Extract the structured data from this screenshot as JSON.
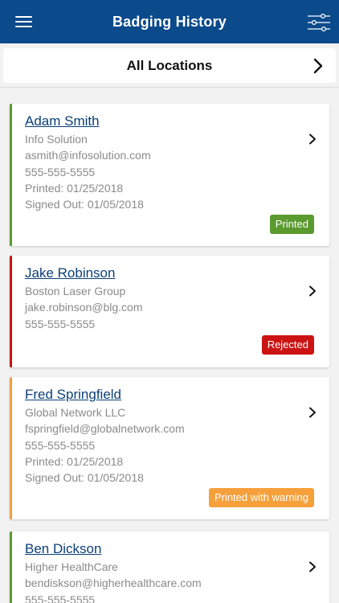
{
  "header": {
    "title": "Badging History",
    "menu_icon": "hamburger-menu-icon",
    "filter_icon": "sliders-filter-icon",
    "bg_color": "#0b4a8b"
  },
  "location_bar": {
    "label": "All Locations",
    "icon": "chevron-right-icon"
  },
  "statuses": {
    "printed": {
      "label": "Printed",
      "color": "#5a9a2f"
    },
    "rejected": {
      "label": "Rejected",
      "color": "#cc1313"
    },
    "warning": {
      "label": "Printed with warning",
      "color": "#f6a03c"
    }
  },
  "cards": [
    {
      "name": "Adam Smith",
      "company": "Info Solution",
      "email": "asmith@infosolution.com",
      "phone": "555-555-5555",
      "printed": "Printed: 01/25/2018",
      "signed_out": "Signed Out: 01/05/2018",
      "status": "Printed",
      "accent": "#5a9a2f"
    },
    {
      "name": "Jake Robinson",
      "company": "Boston Laser Group",
      "email": "jake.robinson@blg.com",
      "phone": "555-555-5555",
      "status": "Rejected",
      "accent": "#cc1313"
    },
    {
      "name": "Fred Springfield",
      "company": "Global Network LLC",
      "email": "fspringfield@globalnetwork.com",
      "phone": "555-555-5555",
      "printed": "Printed: 01/25/2018",
      "signed_out": "Signed Out: 01/05/2018",
      "status": "Printed with warning",
      "accent": "#f6a03c"
    },
    {
      "name": "Ben Dickson",
      "company": "Higher HealthCare",
      "email": "bendiskson@higherhealthcare.com",
      "phone": "555-555-5555",
      "accent": "#5a9a2f"
    }
  ]
}
